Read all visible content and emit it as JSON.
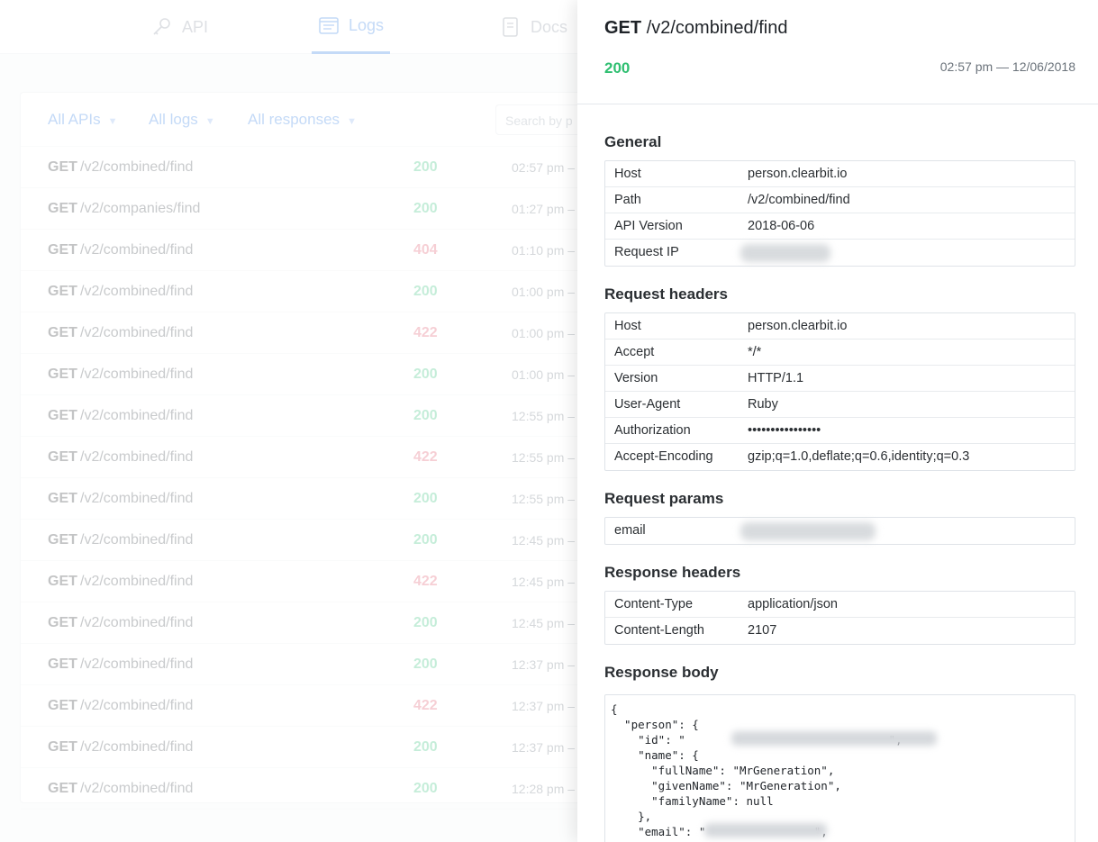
{
  "nav": {
    "tabs": [
      {
        "label": "API",
        "icon": "key-icon"
      },
      {
        "label": "Logs",
        "icon": "logs-icon",
        "active": true
      },
      {
        "label": "Docs",
        "icon": "docs-icon"
      }
    ]
  },
  "filters": {
    "apis": "All APIs",
    "logs": "All logs",
    "responses": "All responses",
    "search_placeholder": "Search by p"
  },
  "logs": [
    {
      "method": "GET",
      "path": "/v2/combined/find",
      "status": "200",
      "time": "02:57 pm –"
    },
    {
      "method": "GET",
      "path": "/v2/companies/find",
      "status": "200",
      "time": "01:27 pm –"
    },
    {
      "method": "GET",
      "path": "/v2/combined/find",
      "status": "404",
      "time": "01:10 pm –"
    },
    {
      "method": "GET",
      "path": "/v2/combined/find",
      "status": "200",
      "time": "01:00 pm –"
    },
    {
      "method": "GET",
      "path": "/v2/combined/find",
      "status": "422",
      "time": "01:00 pm –"
    },
    {
      "method": "GET",
      "path": "/v2/combined/find",
      "status": "200",
      "time": "01:00 pm –"
    },
    {
      "method": "GET",
      "path": "/v2/combined/find",
      "status": "200",
      "time": "12:55 pm –"
    },
    {
      "method": "GET",
      "path": "/v2/combined/find",
      "status": "422",
      "time": "12:55 pm –"
    },
    {
      "method": "GET",
      "path": "/v2/combined/find",
      "status": "200",
      "time": "12:55 pm –"
    },
    {
      "method": "GET",
      "path": "/v2/combined/find",
      "status": "200",
      "time": "12:45 pm –"
    },
    {
      "method": "GET",
      "path": "/v2/combined/find",
      "status": "422",
      "time": "12:45 pm –"
    },
    {
      "method": "GET",
      "path": "/v2/combined/find",
      "status": "200",
      "time": "12:45 pm –"
    },
    {
      "method": "GET",
      "path": "/v2/combined/find",
      "status": "200",
      "time": "12:37 pm –"
    },
    {
      "method": "GET",
      "path": "/v2/combined/find",
      "status": "422",
      "time": "12:37 pm –"
    },
    {
      "method": "GET",
      "path": "/v2/combined/find",
      "status": "200",
      "time": "12:37 pm –"
    },
    {
      "method": "GET",
      "path": "/v2/combined/find",
      "status": "200",
      "time": "12:28 pm –"
    }
  ],
  "detail": {
    "method": "GET",
    "path": "/v2/combined/find",
    "status": "200",
    "timestamp": "02:57 pm — 12/06/2018",
    "general_title": "General",
    "general": [
      {
        "key": "Host",
        "value": "person.clearbit.io"
      },
      {
        "key": "Path",
        "value": "/v2/combined/find"
      },
      {
        "key": "API Version",
        "value": "2018-06-06"
      },
      {
        "key": "Request IP",
        "value": ""
      }
    ],
    "request_headers_title": "Request headers",
    "request_headers": [
      {
        "key": "Host",
        "value": "person.clearbit.io"
      },
      {
        "key": "Accept",
        "value": "*/*"
      },
      {
        "key": "Version",
        "value": "HTTP/1.1"
      },
      {
        "key": "User-Agent",
        "value": "Ruby"
      },
      {
        "key": "Authorization",
        "value": "••••••••••••••••"
      },
      {
        "key": "Accept-Encoding",
        "value": "gzip;q=1.0,deflate;q=0.6,identity;q=0.3"
      }
    ],
    "request_params_title": "Request params",
    "request_params": [
      {
        "key": "email",
        "value": ""
      }
    ],
    "response_headers_title": "Response headers",
    "response_headers": [
      {
        "key": "Content-Type",
        "value": "application/json"
      },
      {
        "key": "Content-Length",
        "value": "2107"
      }
    ],
    "response_body_title": "Response body",
    "response_body": "{\n  \"person\": {\n    \"id\": \"                              \",\n    \"name\": {\n      \"fullName\": \"MrGeneration\",\n      \"givenName\": \"MrGeneration\",\n      \"familyName\": null\n    },\n    \"email\": \"                \",\n    \"location\": null,"
  },
  "colors": {
    "accent": "#2f7ee6",
    "ok": "#33c27a",
    "error": "#e2566a"
  }
}
